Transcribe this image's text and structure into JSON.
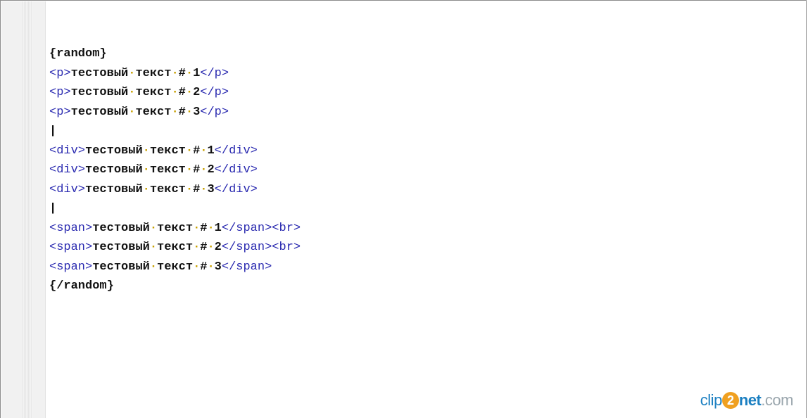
{
  "editor": {
    "lines": [
      {
        "kind": "plain",
        "text": "{random}"
      },
      {
        "kind": "tagline",
        "open": "<p>",
        "text": "тестовый·текст·#·1",
        "close": "</p>"
      },
      {
        "kind": "tagline",
        "open": "<p>",
        "text": "тестовый·текст·#·2",
        "close": "</p>"
      },
      {
        "kind": "tagline",
        "open": "<p>",
        "text": "тестовый·текст·#·3",
        "close": "</p>"
      },
      {
        "kind": "pipe",
        "text": "|"
      },
      {
        "kind": "tagline",
        "open": "<div>",
        "text": "тестовый·текст·#·1",
        "close": "</div>"
      },
      {
        "kind": "tagline",
        "open": "<div>",
        "text": "тестовый·текст·#·2",
        "close": "</div>"
      },
      {
        "kind": "tagline",
        "open": "<div>",
        "text": "тестовый·текст·#·3",
        "close": "</div>"
      },
      {
        "kind": "pipe",
        "text": "|"
      },
      {
        "kind": "tagline",
        "open": "<span>",
        "text": "тестовый·текст·#·1",
        "close": "</span><br>"
      },
      {
        "kind": "tagline",
        "open": "<span>",
        "text": "тестовый·текст·#·2",
        "close": "</span><br>"
      },
      {
        "kind": "tagline",
        "open": "<span>",
        "text": "тестовый·текст·#·3",
        "close": "</span>"
      },
      {
        "kind": "plain",
        "text": "{/random}"
      }
    ]
  },
  "watermark": {
    "part1": "clip",
    "part2": "2",
    "part3": "net",
    "part4": ".com"
  },
  "colors": {
    "tag": "#2a2ab0",
    "text": "#111111",
    "whitespace_dot": "#c8a000",
    "watermark_blue": "#1b7fc1",
    "watermark_orange": "#f0a020"
  }
}
